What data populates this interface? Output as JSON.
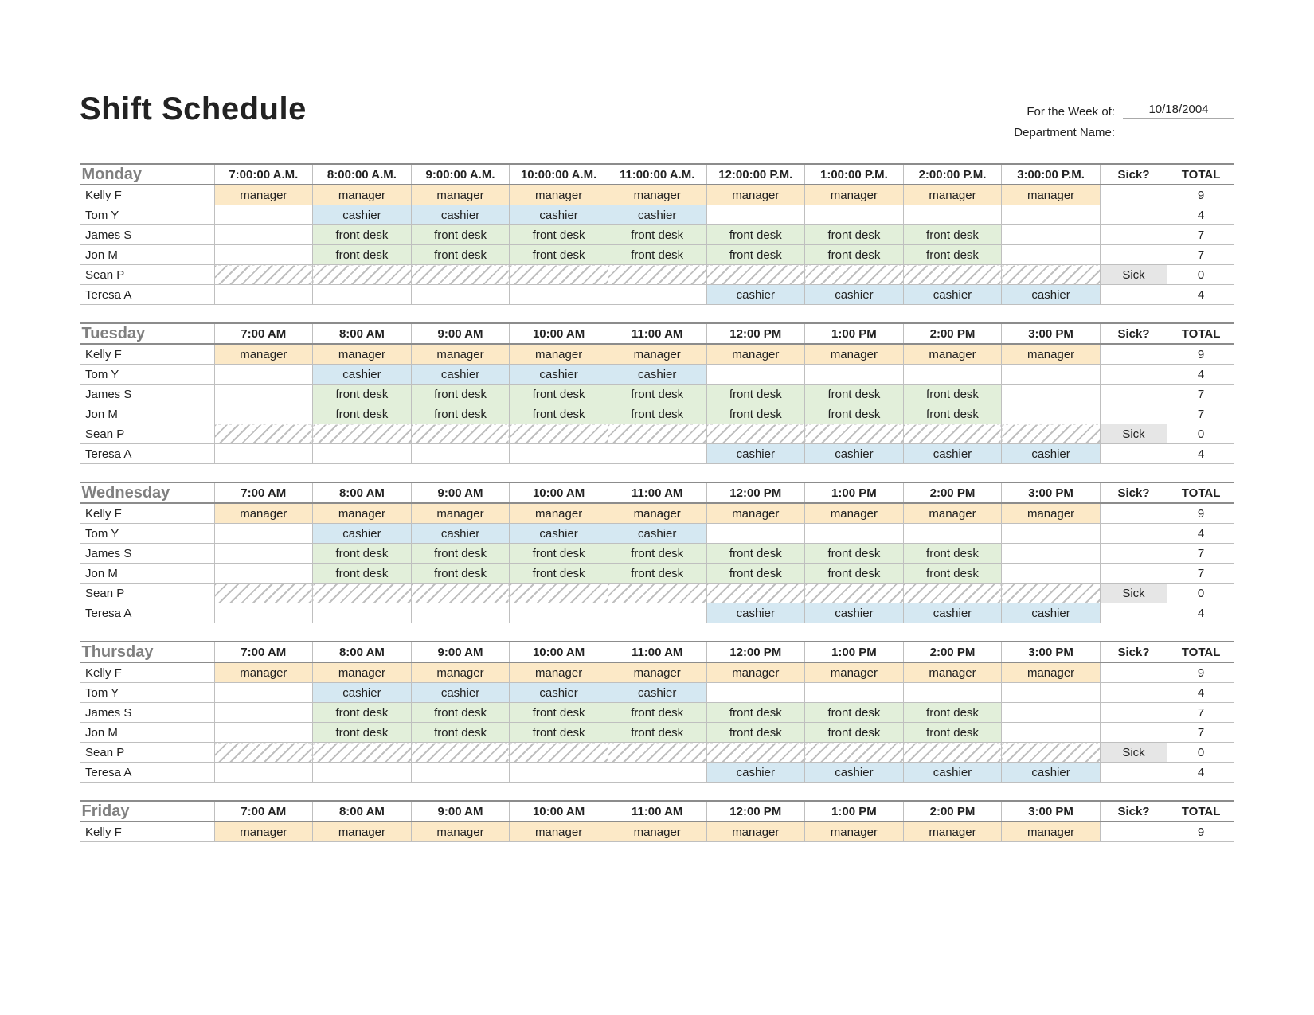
{
  "title": "Shift Schedule",
  "meta": {
    "week_label": "For the Week of:",
    "week_value": "10/18/2004",
    "dept_label": "Department Name:",
    "dept_value": ""
  },
  "columns": {
    "sick": "Sick?",
    "total": "TOTAL"
  },
  "roles": {
    "manager": "manager",
    "cashier": "cashier",
    "front_desk": "front desk"
  },
  "employees": [
    "Kelly F",
    "Tom Y",
    "James S",
    "Jon M",
    "Sean P",
    "Teresa A"
  ],
  "standard_rows": [
    {
      "name": "Kelly F",
      "role": "manager",
      "start": 0,
      "end": 9,
      "sick": "",
      "total": 9
    },
    {
      "name": "Tom Y",
      "role": "cashier",
      "start": 1,
      "end": 5,
      "sick": "",
      "total": 4
    },
    {
      "name": "James S",
      "role": "front_desk",
      "start": 1,
      "end": 8,
      "sick": "",
      "total": 7
    },
    {
      "name": "Jon M",
      "role": "front_desk",
      "start": 1,
      "end": 8,
      "sick": "",
      "total": 7
    },
    {
      "name": "Sean P",
      "role": null,
      "start": 0,
      "end": 0,
      "sick": "Sick",
      "total": 0
    },
    {
      "name": "Teresa A",
      "role": "cashier",
      "start": 5,
      "end": 9,
      "sick": "",
      "total": 4
    }
  ],
  "days": [
    {
      "name": "Monday",
      "times": [
        "7:00:00 A.M.",
        "8:00:00 A.M.",
        "9:00:00 A.M.",
        "10:00:00 A.M.",
        "11:00:00 A.M.",
        "12:00:00 P.M.",
        "1:00:00 P.M.",
        "2:00:00 P.M.",
        "3:00:00 P.M."
      ],
      "rows": "standard"
    },
    {
      "name": "Tuesday",
      "times": [
        "7:00 AM",
        "8:00 AM",
        "9:00 AM",
        "10:00 AM",
        "11:00 AM",
        "12:00 PM",
        "1:00 PM",
        "2:00 PM",
        "3:00 PM"
      ],
      "rows": "standard"
    },
    {
      "name": "Wednesday",
      "times": [
        "7:00 AM",
        "8:00 AM",
        "9:00 AM",
        "10:00 AM",
        "11:00 AM",
        "12:00 PM",
        "1:00 PM",
        "2:00 PM",
        "3:00 PM"
      ],
      "rows": "standard"
    },
    {
      "name": "Thursday",
      "times": [
        "7:00 AM",
        "8:00 AM",
        "9:00 AM",
        "10:00 AM",
        "11:00 AM",
        "12:00 PM",
        "1:00 PM",
        "2:00 PM",
        "3:00 PM"
      ],
      "rows": "standard"
    },
    {
      "name": "Friday",
      "times": [
        "7:00 AM",
        "8:00 AM",
        "9:00 AM",
        "10:00 AM",
        "11:00 AM",
        "12:00 PM",
        "1:00 PM",
        "2:00 PM",
        "3:00 PM"
      ],
      "rows": [
        {
          "name": "Kelly F",
          "role": "manager",
          "start": 0,
          "end": 9,
          "sick": "",
          "total": 9
        }
      ]
    }
  ]
}
